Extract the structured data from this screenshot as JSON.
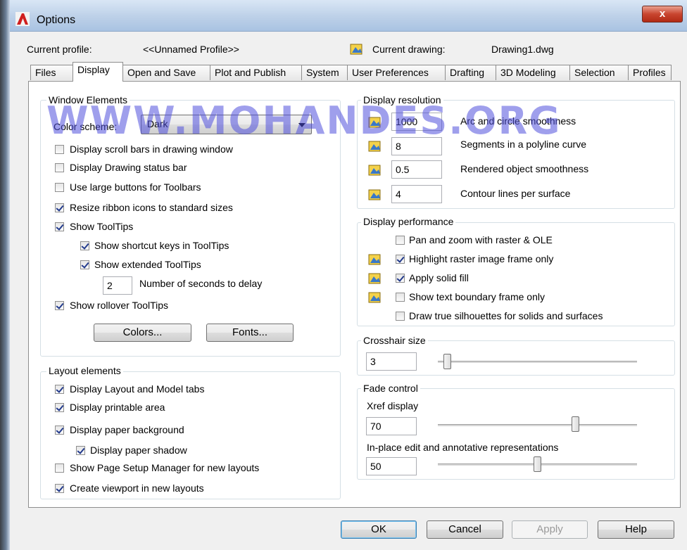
{
  "window": {
    "title": "Options",
    "close_label": "x"
  },
  "profile": {
    "current_profile_label": "Current profile:",
    "current_profile_value": "<<Unnamed Profile>>",
    "current_drawing_label": "Current drawing:",
    "current_drawing_value": "Drawing1.dwg"
  },
  "tabs": [
    "Files",
    "Display",
    "Open and Save",
    "Plot and Publish",
    "System",
    "User Preferences",
    "Drafting",
    "3D Modeling",
    "Selection",
    "Profiles"
  ],
  "active_tab": "Display",
  "watermark": "WWW.MOHANDES.ORG",
  "window_elements": {
    "title": "Window Elements",
    "color_scheme_label": "Color scheme:",
    "color_scheme_value": "Dark",
    "options": [
      {
        "label": "Display scroll bars in drawing window",
        "checked": false
      },
      {
        "label": "Display Drawing status bar",
        "checked": false
      },
      {
        "label": "Use large buttons for Toolbars",
        "checked": false
      },
      {
        "label": "Resize ribbon icons to standard sizes",
        "checked": true
      },
      {
        "label": "Show ToolTips",
        "checked": true
      },
      {
        "label": "Show shortcut keys in ToolTips",
        "checked": true
      },
      {
        "label": "Show extended ToolTips",
        "checked": true
      },
      {
        "label": "Show rollover ToolTips",
        "checked": true
      }
    ],
    "delay_value": "2",
    "delay_label": "Number of seconds to delay",
    "colors_button": "Colors...",
    "fonts_button": "Fonts..."
  },
  "layout_elements": {
    "title": "Layout elements",
    "options": [
      {
        "label": "Display Layout and Model tabs",
        "checked": true
      },
      {
        "label": "Display printable area",
        "checked": true
      },
      {
        "label": "Display paper background",
        "checked": true
      },
      {
        "label": "Display paper shadow",
        "checked": true
      },
      {
        "label": "Show Page Setup Manager for new layouts",
        "checked": false
      },
      {
        "label": "Create viewport in new layouts",
        "checked": true
      }
    ]
  },
  "display_resolution": {
    "title": "Display resolution",
    "items": [
      {
        "value": "1000",
        "label": "Arc and circle smoothness"
      },
      {
        "value": "8",
        "label": "Segments in a polyline curve"
      },
      {
        "value": "0.5",
        "label": "Rendered object smoothness"
      },
      {
        "value": "4",
        "label": "Contour lines per surface"
      }
    ]
  },
  "display_performance": {
    "title": "Display performance",
    "options": [
      {
        "label": "Pan and zoom with raster & OLE",
        "checked": false
      },
      {
        "label": "Highlight raster image frame only",
        "checked": true
      },
      {
        "label": "Apply solid fill",
        "checked": true
      },
      {
        "label": "Show text boundary frame only",
        "checked": false
      },
      {
        "label": "Draw true silhouettes for solids and surfaces",
        "checked": false
      }
    ]
  },
  "crosshair": {
    "title": "Crosshair size",
    "value": "3",
    "slider_fraction": 0.03
  },
  "fade_control": {
    "title": "Fade control",
    "xref_label": "Xref display",
    "xref_value": "70",
    "xref_fraction": 0.7,
    "inplace_label": "In-place edit and annotative representations",
    "inplace_value": "50",
    "inplace_fraction": 0.5
  },
  "footer": {
    "ok": "OK",
    "cancel": "Cancel",
    "apply": "Apply",
    "help": "Help"
  },
  "colors": {
    "checkmark": "#223a8c",
    "close_button": "#c8452f",
    "watermark": "#5050dc"
  }
}
